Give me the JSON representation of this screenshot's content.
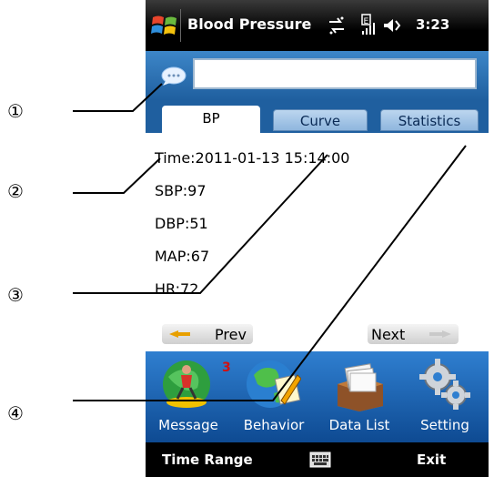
{
  "titlebar": {
    "title": "Blood Pressure",
    "time": "3:23"
  },
  "tabs": [
    {
      "label": "BP",
      "active": true
    },
    {
      "label": "Curve",
      "active": false
    },
    {
      "label": "Statistics",
      "active": false
    }
  ],
  "reading": {
    "time": "Time:2011-01-13 15:14:00",
    "sbp": "SBP:97",
    "dbp": "DBP:51",
    "map": "MAP:67",
    "hr": "HR:72"
  },
  "nav": {
    "prev": "Prev",
    "next": "Next"
  },
  "dock": [
    {
      "label": "Message",
      "icon": "message-icon",
      "badge": "3"
    },
    {
      "label": "Behavior",
      "icon": "behavior-icon"
    },
    {
      "label": "Data List",
      "icon": "data-list-icon"
    },
    {
      "label": "Setting",
      "icon": "setting-icon"
    }
  ],
  "softkeys": {
    "left": "Time Range",
    "right": "Exit"
  },
  "annotations": [
    "①",
    "②",
    "③",
    "④"
  ],
  "colors": {
    "accent": "#1f5f9f",
    "badge": "#d21010"
  }
}
